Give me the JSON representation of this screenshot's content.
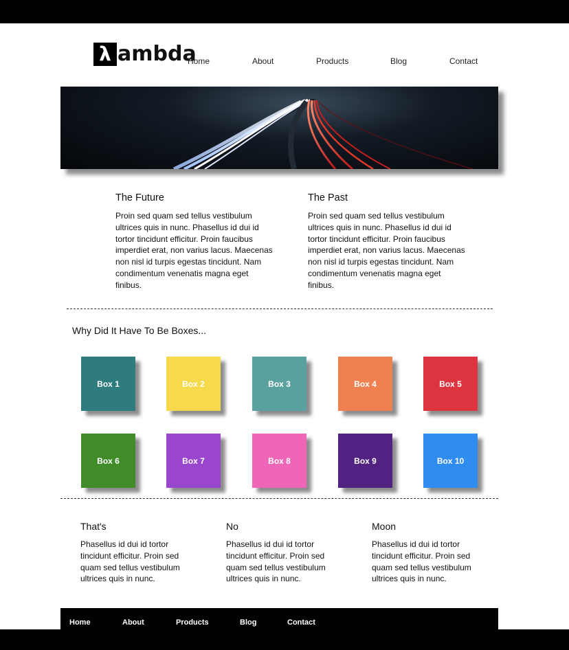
{
  "header": {
    "logo_mark": "λ",
    "logo_text": "ambda",
    "nav": [
      "Home",
      "About",
      "Products",
      "Blog",
      "Contact"
    ]
  },
  "columns": [
    {
      "title": "The Future",
      "body": "Proin sed quam sed tellus vestibulum ultrices quis in nunc. Phasellus id dui id tortor tincidunt efficitur. Proin faucibus imperdiet erat, non varius lacus. Maecenas non nisl id turpis egestas tincidunt. Nam condimentum venenatis magna eget finibus."
    },
    {
      "title": "The Past",
      "body": "Proin sed quam sed tellus vestibulum ultrices quis in nunc. Phasellus id dui id tortor tincidunt efficitur. Proin faucibus imperdiet erat, non varius lacus. Maecenas non nisl id turpis egestas tincidunt. Nam condimentum venenatis magna eget finibus."
    }
  ],
  "boxes_section": {
    "title": "Why Did It Have To Be Boxes...",
    "boxes": [
      {
        "label": "Box 1",
        "color": "#2f7c7e"
      },
      {
        "label": "Box 2",
        "color": "#f7d94c"
      },
      {
        "label": "Box 3",
        "color": "#5aa09f"
      },
      {
        "label": "Box 4",
        "color": "#ef8150"
      },
      {
        "label": "Box 5",
        "color": "#dd3440"
      },
      {
        "label": "Box 6",
        "color": "#3f8c29"
      },
      {
        "label": "Box 7",
        "color": "#9a45cd"
      },
      {
        "label": "Box 8",
        "color": "#ef66b8"
      },
      {
        "label": "Box 9",
        "color": "#512282"
      },
      {
        "label": "Box 10",
        "color": "#2f8cf0"
      }
    ]
  },
  "bottom": [
    {
      "title": "That's",
      "body": "Phasellus id dui id tortor tincidunt efficitur. Proin sed quam sed tellus vestibulum ultrices quis in nunc."
    },
    {
      "title": "No",
      "body": "Phasellus id dui id tortor tincidunt efficitur. Proin sed quam sed tellus vestibulum ultrices quis in nunc."
    },
    {
      "title": "Moon",
      "body": "Phasellus id dui id tortor tincidunt efficitur. Proin sed quam sed tellus vestibulum ultrices quis in nunc."
    }
  ],
  "footer": {
    "nav": [
      "Home",
      "About",
      "Products",
      "Blog",
      "Contact"
    ]
  }
}
